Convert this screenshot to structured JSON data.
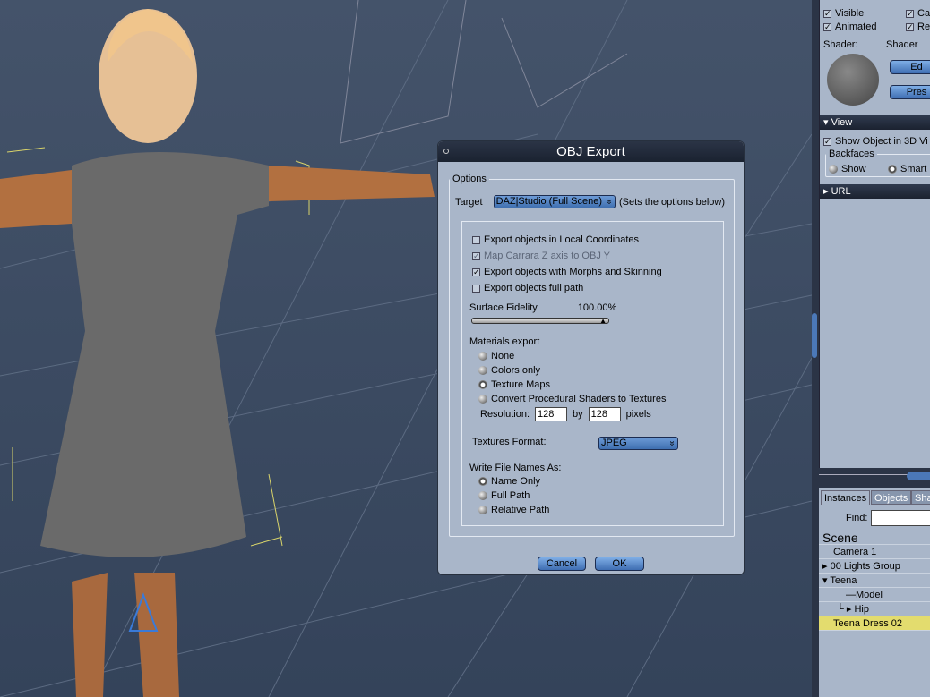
{
  "dialog": {
    "title": "OBJ Export",
    "options_legend": "Options",
    "target_label": "Target",
    "target_value": "DAZ|Studio (Full Scene)",
    "target_note": "(Sets the options below)",
    "checks": [
      {
        "label": "Export objects in Local Coordinates",
        "checked": false,
        "disabled": false
      },
      {
        "label": "Map Carrara Z axis to OBJ  Y",
        "checked": true,
        "disabled": true
      },
      {
        "label": "Export objects with Morphs and Skinning",
        "checked": true,
        "disabled": false
      },
      {
        "label": "Export objects full path",
        "checked": false,
        "disabled": false
      }
    ],
    "fidelity_label": "Surface Fidelity",
    "fidelity_value": "100.00%",
    "fidelity_fraction": 1.0,
    "materials_label": "Materials export",
    "materials": [
      "None",
      "Colors only",
      "Texture Maps",
      "Convert Procedural Shaders to Textures"
    ],
    "materials_selected": "Texture Maps",
    "resolution_label": "Resolution:",
    "res_w": "128",
    "by": "by",
    "res_h": "128",
    "pixels": "pixels",
    "textures_label": "Textures Format:",
    "textures_value": "JPEG",
    "filenames_label": "Write File Names As:",
    "filenames": [
      "Name Only",
      "Full Path",
      "Relative Path"
    ],
    "filenames_selected": "Name Only",
    "cancel": "Cancel",
    "ok": "OK"
  },
  "panel": {
    "visible": "Visible",
    "animated": "Animated",
    "ca": "Ca",
    "re": "Re",
    "shader_label": "Shader:",
    "shader_value": "Shader",
    "edit": "Ed",
    "preset": "Pres",
    "view_header": "View",
    "show_object": "Show Object in 3D Vi",
    "backfaces": "Backfaces",
    "show": "Show",
    "smart": "Smart",
    "url_header": "URL",
    "tabs": [
      "Instances",
      "Objects",
      "Sha"
    ],
    "find_label": "Find:",
    "tree": [
      {
        "label": "Scene"
      },
      {
        "label": "Camera 1"
      },
      {
        "label": "00 Lights Group"
      },
      {
        "label": "Teena"
      },
      {
        "label": "Model"
      },
      {
        "label": "Hip"
      },
      {
        "label": "Teena Dress 02",
        "selected": true
      }
    ]
  }
}
